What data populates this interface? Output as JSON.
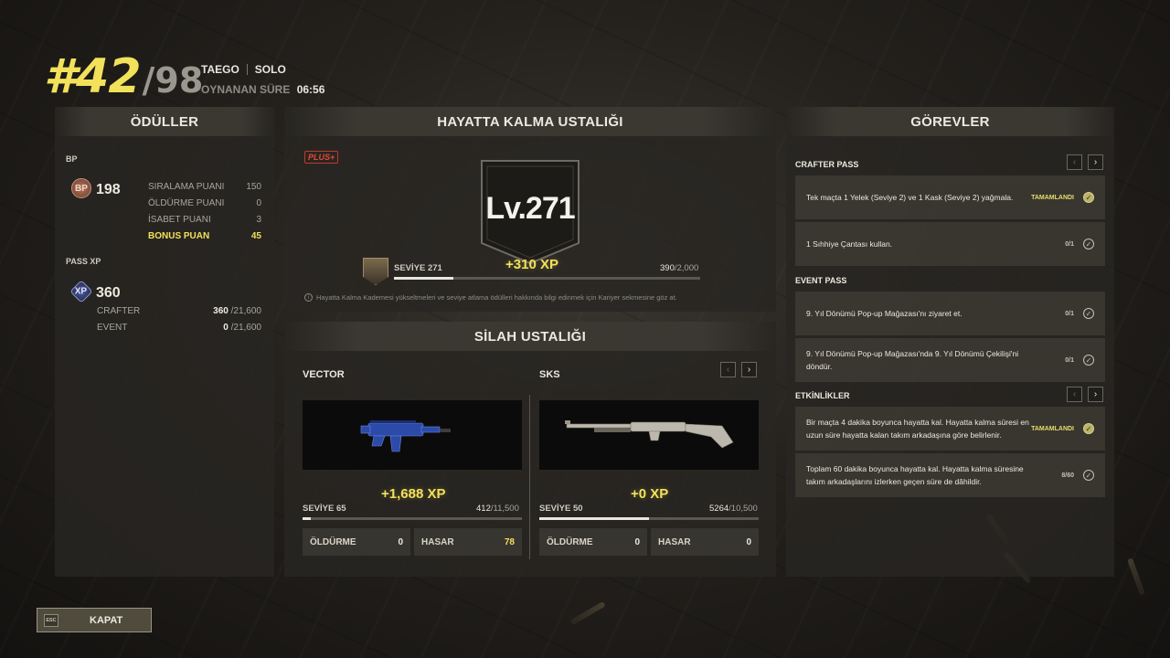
{
  "header": {
    "rank": "#42",
    "rank_total": "/98",
    "player": "TAEGO",
    "mode": "SOLO",
    "time_label": "OYNANAN SÜRE",
    "time_value": "06:56"
  },
  "rewards": {
    "title": "ÖDÜLLER",
    "bp_section": "BP",
    "bp_icon": "BP",
    "bp_total": "198",
    "bp_rows": [
      {
        "label": "SIRALAMA PUANI",
        "value": "150"
      },
      {
        "label": "ÖLDÜRME PUANI",
        "value": "0"
      },
      {
        "label": "İSABET PUANI",
        "value": "3"
      },
      {
        "label": "BONUS PUAN",
        "value": "45"
      }
    ],
    "xp_section": "PASS XP",
    "xp_icon": "XP",
    "xp_total": "360",
    "xp_rows": [
      {
        "label": "CRAFTER",
        "value": "360",
        "max": "/21,600"
      },
      {
        "label": "EVENT",
        "value": "0",
        "max": "/21,600"
      }
    ]
  },
  "survival": {
    "title": "HAYATTA KALMA USTALIĞI",
    "plus_badge": "PLUS+",
    "level": "Lv.271",
    "xp_gain": "+310 XP",
    "seviye_label": "SEVİYE 271",
    "progress_value": "390",
    "progress_max": "/2,000",
    "progress_fraction": 0.195,
    "info": "Hayatta Kalma Kademesi yükseltmeleri ve seviye atlama ödülleri hakkında bilgi edinmek için Kariyer sekmesine göz at."
  },
  "weapons": {
    "title": "SİLAH USTALIĞI",
    "items": [
      {
        "name": "VECTOR",
        "xp_gain": "+1,688 XP",
        "level": "SEVİYE 65",
        "progress_value": "412",
        "progress_max": "/11,500",
        "progress_fraction": 0.036,
        "kill_label": "ÖLDÜRME",
        "kills": "0",
        "damage_label": "HASAR",
        "damage": "78"
      },
      {
        "name": "SKS",
        "xp_gain": "+0 XP",
        "level": "SEVİYE 50",
        "progress_value": "5264",
        "progress_max": "/10,500",
        "progress_fraction": 0.501,
        "kill_label": "ÖLDÜRME",
        "kills": "0",
        "damage_label": "HASAR",
        "damage": "0"
      }
    ]
  },
  "missions": {
    "title": "GÖREVLER",
    "sections": [
      {
        "label": "CRAFTER PASS"
      },
      {
        "label": "EVENT PASS"
      },
      {
        "label": "ETKİNLİKLER"
      }
    ],
    "items": [
      {
        "text": "Tek maçta 1 Yelek (Seviye 2) ve 1 Kask (Seviye 2) yağmala.",
        "status": "TAMAMLANDI"
      },
      {
        "text": "1 Sıhhiye Çantası kullan.",
        "status": "0/1"
      },
      {
        "text": "9. Yıl Dönümü Pop-up Mağazası'nı ziyaret et.",
        "status": "0/1"
      },
      {
        "text": "9. Yıl Dönümü Pop-up Mağazası'nda 9. Yıl Dönümü Çekilişi'ni döndür.",
        "status": "0/1"
      },
      {
        "text": "Bir maçta 4 dakika boyunca hayatta kal. Hayatta kalma süresi en uzun süre hayatta kalan takım arkadaşına göre belirlenir.",
        "status": "TAMAMLANDI"
      },
      {
        "text": "Toplam 60 dakika boyunca hayatta kal. Hayatta kalma süresine takım arkadaşlarını izlerken geçen süre de dâhildir.",
        "status": "8/60"
      }
    ]
  },
  "footer": {
    "esc_key": "ESC",
    "close_label": "KAPAT"
  },
  "colors": {
    "accent_yellow": "#f2e15a",
    "panel_bg": "#28261f",
    "text_primary": "#ece9df"
  }
}
